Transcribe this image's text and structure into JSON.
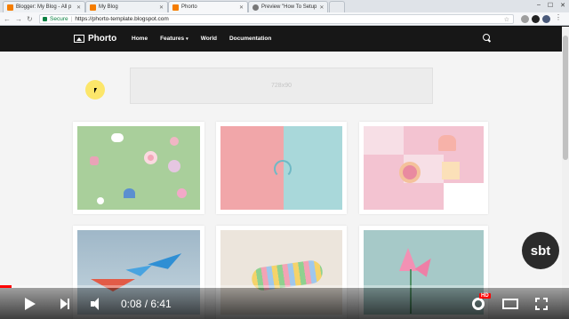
{
  "browser": {
    "tabs": [
      {
        "label": "Blogger: My Blog - All p",
        "icon": "blogger-icon"
      },
      {
        "label": "My Blog",
        "icon": "blogger-icon"
      },
      {
        "label": "Phorto",
        "icon": "blogger-icon",
        "active": true
      },
      {
        "label": "Preview \"How To Setup",
        "icon": "globe-icon"
      }
    ],
    "secure_label": "Secure",
    "url": "https://phorto-template.blogspot.com"
  },
  "site": {
    "logo_text": "Phorto",
    "menu": [
      {
        "label": "Home"
      },
      {
        "label": "Features",
        "caret": "▾"
      },
      {
        "label": "World"
      },
      {
        "label": "Documentation"
      }
    ],
    "ad_text": "728x90"
  },
  "player": {
    "time_text": "0:08 / 6:41",
    "progress_fraction": 0.02,
    "hd_badge": "HD",
    "watermark_text": "sbt"
  },
  "colors": {
    "nav_bg": "#171717",
    "progress": "#ff0000",
    "cursor_highlight": "#ffe23c"
  }
}
